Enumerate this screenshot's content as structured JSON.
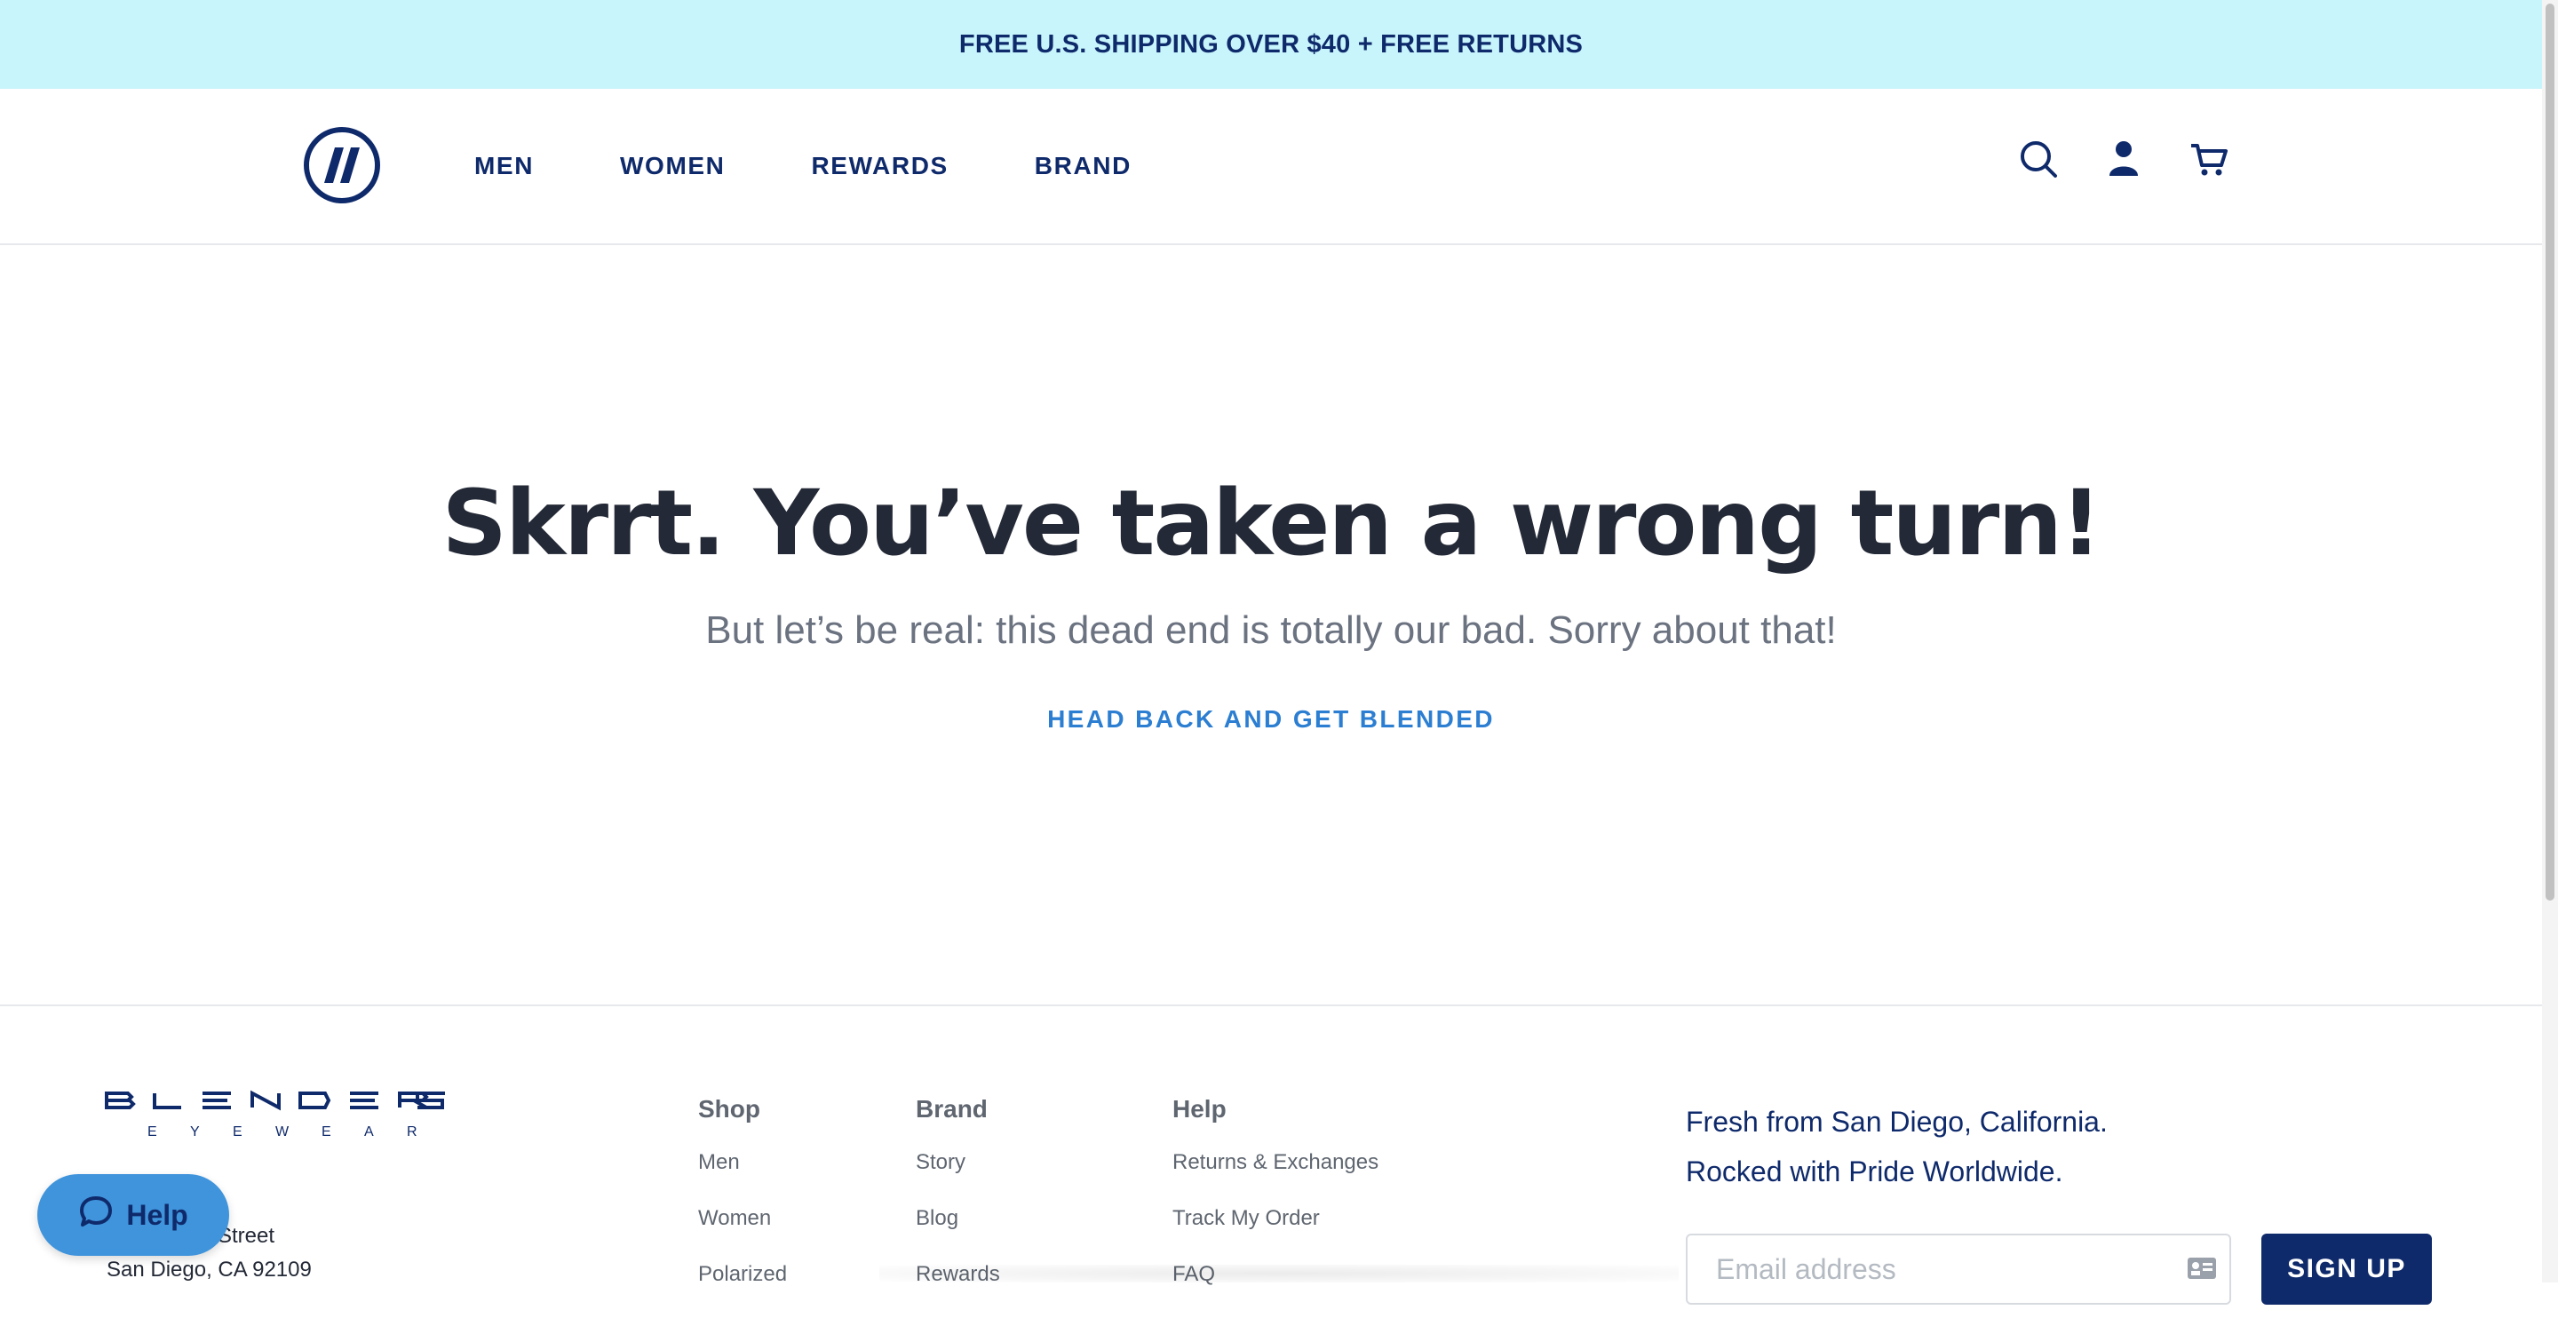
{
  "promo": {
    "text": "FREE U.S. SHIPPING OVER $40 + FREE RETURNS"
  },
  "nav": {
    "items": [
      "MEN",
      "WOMEN",
      "REWARDS",
      "BRAND"
    ]
  },
  "header_icons": [
    "search-icon",
    "account-icon",
    "cart-icon"
  ],
  "error": {
    "headline": "Skrrt. You’ve taken a wrong turn!",
    "subline": "But let’s be real: this dead end is totally our bad. Sorry about that!",
    "cta": "HEAD BACK AND GET BLENDED"
  },
  "footer": {
    "brand_logo": "BLENDERS EYEWEAR",
    "address": {
      "line1": "Street",
      "line2": "San Diego, CA 92109"
    },
    "columns": [
      {
        "title": "Shop",
        "links": [
          "Men",
          "Women",
          "Polarized"
        ]
      },
      {
        "title": "Brand",
        "links": [
          "Story",
          "Blog",
          "Rewards"
        ]
      },
      {
        "title": "Help",
        "links": [
          "Returns & Exchanges",
          "Track My Order",
          "FAQ"
        ]
      }
    ],
    "tagline": {
      "line1": "Fresh from San Diego, California.",
      "line2": "Rocked with Pride Worldwide."
    },
    "newsletter": {
      "placeholder": "Email address",
      "button": "SIGN UP"
    }
  },
  "help_widget": {
    "label": "Help"
  },
  "colors": {
    "navy": "#0f2a6b",
    "promo_bg": "#c8f5fc",
    "cta_blue": "#2b7ed1",
    "help_bg": "#3f94dc"
  }
}
